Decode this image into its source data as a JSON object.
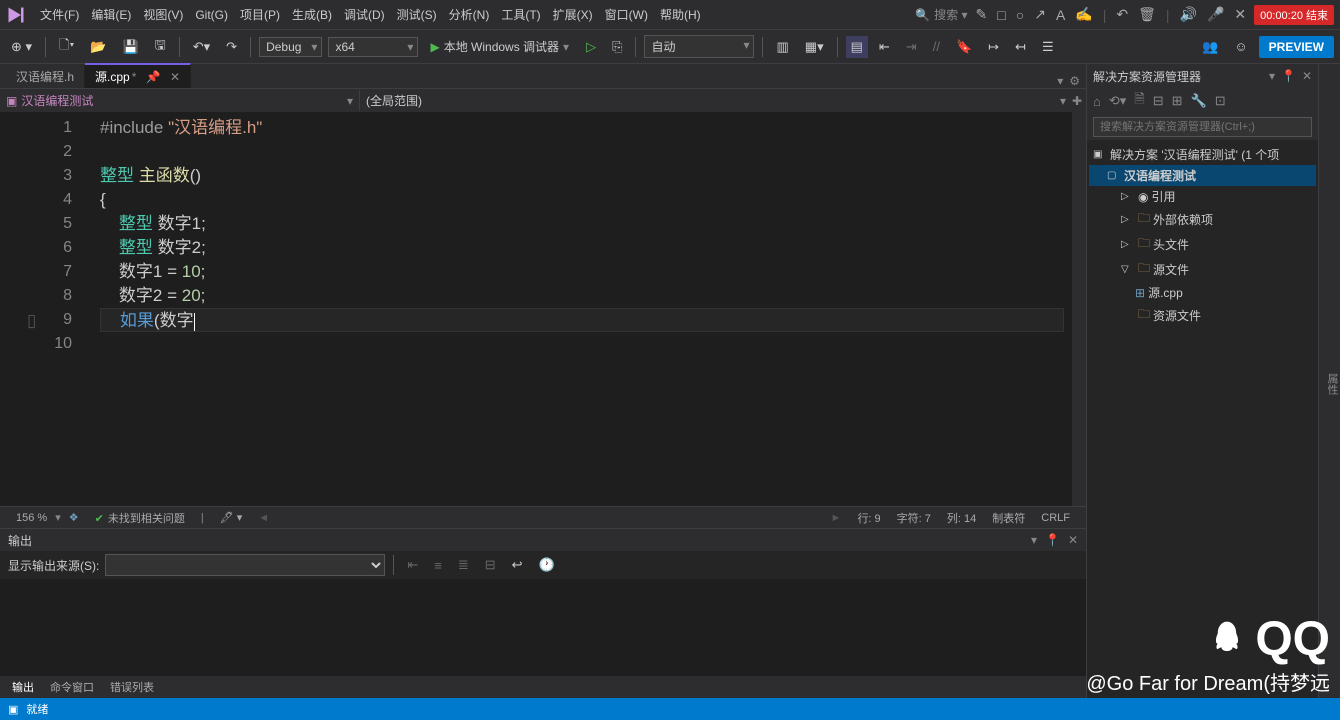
{
  "menu": {
    "items": [
      "文件(F)",
      "编辑(E)",
      "视图(V)",
      "Git(G)",
      "项目(P)",
      "生成(B)",
      "调试(D)",
      "测试(S)",
      "分析(N)",
      "工具(T)",
      "扩展(X)",
      "窗口(W)",
      "帮助(H)"
    ],
    "search_placeholder": "搜索 ▾"
  },
  "timer": "00:00:20 结束",
  "toolbar": {
    "config": "Debug",
    "platform": "x64",
    "debugger": "本地 Windows 调试器",
    "auto": "自动",
    "preview": "PREVIEW"
  },
  "tabs": {
    "t0": "汉语编程.h",
    "t1": "源.cpp",
    "t1_mod": "*"
  },
  "scope": {
    "left": "汉语编程测试",
    "right": "(全局范围)"
  },
  "code": {
    "lines": [
      {
        "n": "1",
        "html": "<span class='pre'>#include </span><span class='str'>\"汉语编程.h\"</span>"
      },
      {
        "n": "2",
        "html": ""
      },
      {
        "n": "3",
        "html": "<span class='type'>整型</span> <span class='ident'>主函数</span>()"
      },
      {
        "n": "4",
        "html": "{"
      },
      {
        "n": "5",
        "html": "    <span class='type'>整型</span> 数字1;"
      },
      {
        "n": "6",
        "html": "    <span class='type'>整型</span> 数字2;"
      },
      {
        "n": "7",
        "html": "    数字1 = <span class='num'>10</span>;"
      },
      {
        "n": "8",
        "html": "    数字2 = <span class='num'>20</span>;"
      },
      {
        "n": "9",
        "html": "    <span class='kw'>如果</span>(数字<span class='cursor-line'></span>",
        "current": true
      },
      {
        "n": "10",
        "html": ""
      }
    ]
  },
  "status": {
    "zoom": "156 %",
    "issues": "未找到相关问题",
    "line": "行: 9",
    "char": "字符: 7",
    "col": "列: 14",
    "tabs": "制表符",
    "eol": "CRLF"
  },
  "output": {
    "title": "输出",
    "source_label": "显示输出来源(S):",
    "tabs": [
      "输出",
      "命令窗口",
      "错误列表"
    ]
  },
  "bottom_status": {
    "ready": "就绪"
  },
  "solution": {
    "title": "解决方案资源管理器",
    "search_placeholder": "搜索解决方案资源管理器(Ctrl+;)",
    "root": "解决方案 '汉语编程测试' (1 个项",
    "project": "汉语编程测试",
    "refs": "引用",
    "ext": "外部依赖项",
    "headers": "头文件",
    "sources": "源文件",
    "source_file": "源.cpp",
    "resources": "资源文件"
  },
  "watermark": {
    "qq": "QQ",
    "handle": "@Go Far for Dream(持梦远"
  },
  "rightstrip": "属性"
}
